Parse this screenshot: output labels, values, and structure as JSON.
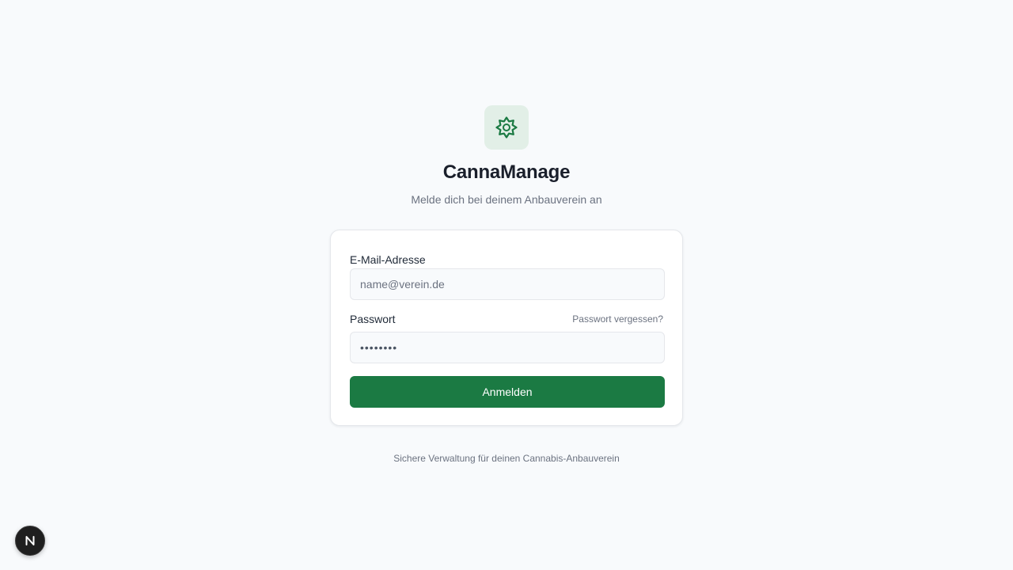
{
  "brand": {
    "logo_icon": "cannabis-leaf-icon",
    "title": "CannaManage",
    "subtitle": "Melde dich bei deinem Anbauverein an",
    "accent_color": "#1b7a43"
  },
  "login_form": {
    "email": {
      "label": "E-Mail-Adresse",
      "placeholder": "name@verein.de",
      "value": ""
    },
    "password": {
      "label": "Passwort",
      "forgot_link": "Passwort vergessen?",
      "value": "••••••••"
    },
    "submit_label": "Anmelden"
  },
  "footer": {
    "note": "Sichere Verwaltung für deinen Cannabis-Anbauverein"
  },
  "dev_indicator": {
    "icon": "nextjs-n-icon",
    "letter": "N"
  }
}
